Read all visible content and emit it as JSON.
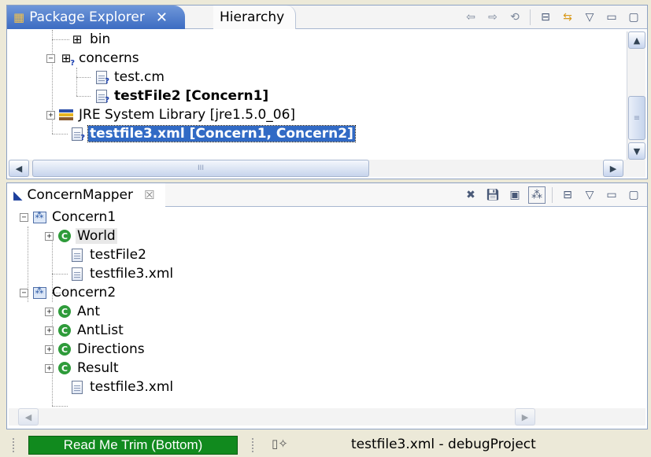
{
  "explorer": {
    "tabs": [
      {
        "label": "Package Explorer",
        "close": "✕"
      },
      {
        "label": "Hierarchy"
      }
    ],
    "toolbar": [
      "back-icon",
      "forward-icon",
      "go-into-icon",
      "collapse-all-icon",
      "link-with-editor-icon",
      "view-menu-icon",
      "minimize-icon",
      "maximize-icon"
    ],
    "tree": [
      {
        "label": "bin",
        "icon": "folder-icon"
      },
      {
        "label": "concerns",
        "icon": "package-folder-icon",
        "expander": "−"
      },
      {
        "label": "test.cm",
        "icon": "file-icon"
      },
      {
        "label": "testFile2 [Concern1]",
        "icon": "file-icon"
      },
      {
        "label": "JRE System Library [jre1.5.0_06]",
        "icon": "library-icon",
        "expander": "+"
      },
      {
        "label": "testfile3.xml [Concern1, Concern2]",
        "icon": "file-icon"
      }
    ],
    "scroll_grip": "III",
    "vscroll_grip": "≡"
  },
  "mapper": {
    "tab": {
      "label": "ConcernMapper",
      "close": "☒"
    },
    "toolbar": [
      "remove-icon",
      "save-icon",
      "save-as-icon",
      "concern-model-icon",
      "collapse-all-icon",
      "view-menu-icon",
      "minimize-icon",
      "maximize-icon"
    ],
    "tree": [
      {
        "label": "Concern1",
        "icon": "concern-icon",
        "expander": "−"
      },
      {
        "label": "World",
        "icon": "class-icon",
        "expander": "+"
      },
      {
        "label": "testFile2",
        "icon": "file-icon"
      },
      {
        "label": "testfile3.xml",
        "icon": "file-icon"
      },
      {
        "label": "Concern2",
        "icon": "concern-icon",
        "expander": "−"
      },
      {
        "label": "Ant",
        "icon": "class-icon",
        "expander": "+"
      },
      {
        "label": "AntList",
        "icon": "class-icon",
        "expander": "+"
      },
      {
        "label": "Directions",
        "icon": "class-icon",
        "expander": "+"
      },
      {
        "label": "Result",
        "icon": "class-icon",
        "expander": "+"
      },
      {
        "label": "testfile3.xml",
        "icon": "file-icon"
      }
    ],
    "class_glyph": "C"
  },
  "status": {
    "trim_label": "Read Me Trim (Bottom)",
    "selection_text": "testfile3.xml - debugProject"
  },
  "colors": {
    "selection": "#316ac5",
    "active_tab": "#3c6cc2",
    "trim_green": "#118a1e",
    "class_green": "#2e9b3a"
  }
}
